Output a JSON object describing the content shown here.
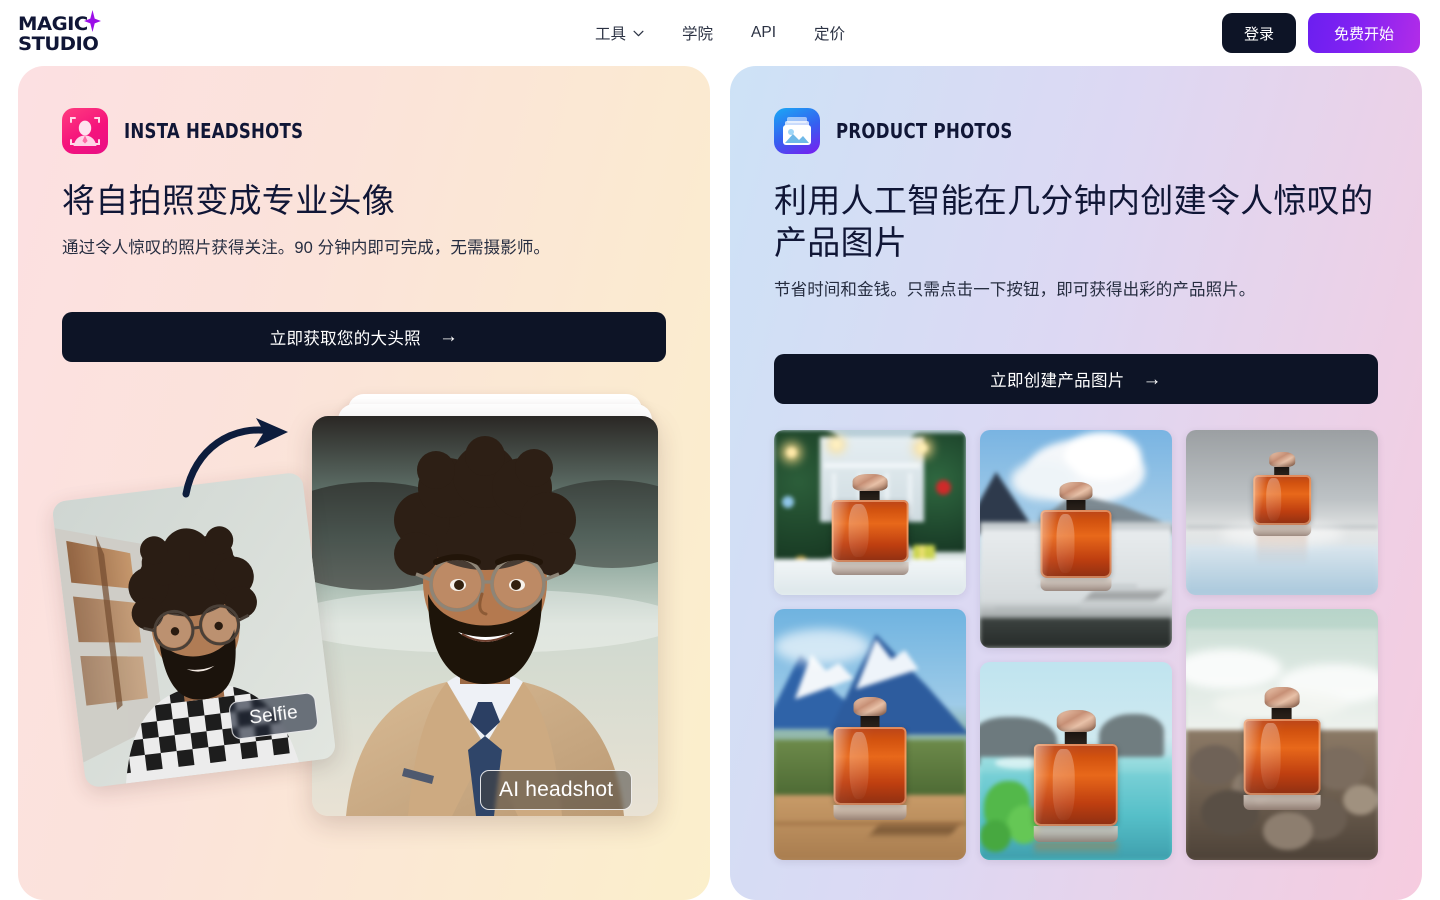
{
  "header": {
    "logo": {
      "line1": "MAGIC",
      "line2": "STUDIO",
      "sparkle_icon": "sparkle-icon"
    },
    "nav": [
      {
        "label": "工具",
        "has_chevron": true,
        "icon": "chevron-down-icon"
      },
      {
        "label": "学院",
        "has_chevron": false
      },
      {
        "label": "API",
        "has_chevron": false
      },
      {
        "label": "定价",
        "has_chevron": false
      }
    ],
    "login_label": "登录",
    "start_label": "免费开始",
    "login_bg": "#0d1426",
    "start_bg": "#8322f2"
  },
  "cards": [
    {
      "id": "insta-headshots",
      "badge": "INSTA HEADSHOTS",
      "icon": "portrait-frame-icon",
      "icon_colors": "#ff3d7f → #e80f86",
      "title": "将自拍照变成专业头像",
      "subtitle": "通过令人惊叹的照片获得关注。90 分钟内即可完成，无需摄影师。",
      "cta": "立即获取您的大头照",
      "cta_arrow": "→",
      "bg_from": "#fce0e2",
      "bg_to": "#fbefcb",
      "labels": {
        "before": "Selfie",
        "after": "AI headshot"
      }
    },
    {
      "id": "product-photos",
      "badge": "PRODUCT PHOTOS",
      "icon": "photo-stack-icon",
      "icon_colors": "#1aa9f5 → #7b1bf0",
      "title": "利用人工智能在几分钟内创建令人惊叹的产品图片",
      "subtitle": "节省时间和金钱。只需点击一下按钮，即可获得出彩的产品照片。",
      "cta": "立即创建产品图片",
      "cta_arrow": "→",
      "bg_from": "#cde2f6",
      "bg_to": "#f6ccdf",
      "gallery": [
        {
          "scene": "holiday-lights-snow"
        },
        {
          "scene": "mountain-wood-table"
        },
        {
          "scene": "marble-cloud-sky"
        },
        {
          "scene": "lagoon-green-leaves"
        },
        {
          "scene": "studio-gray-gradient"
        },
        {
          "scene": "ocean-pebbles"
        }
      ]
    }
  ]
}
